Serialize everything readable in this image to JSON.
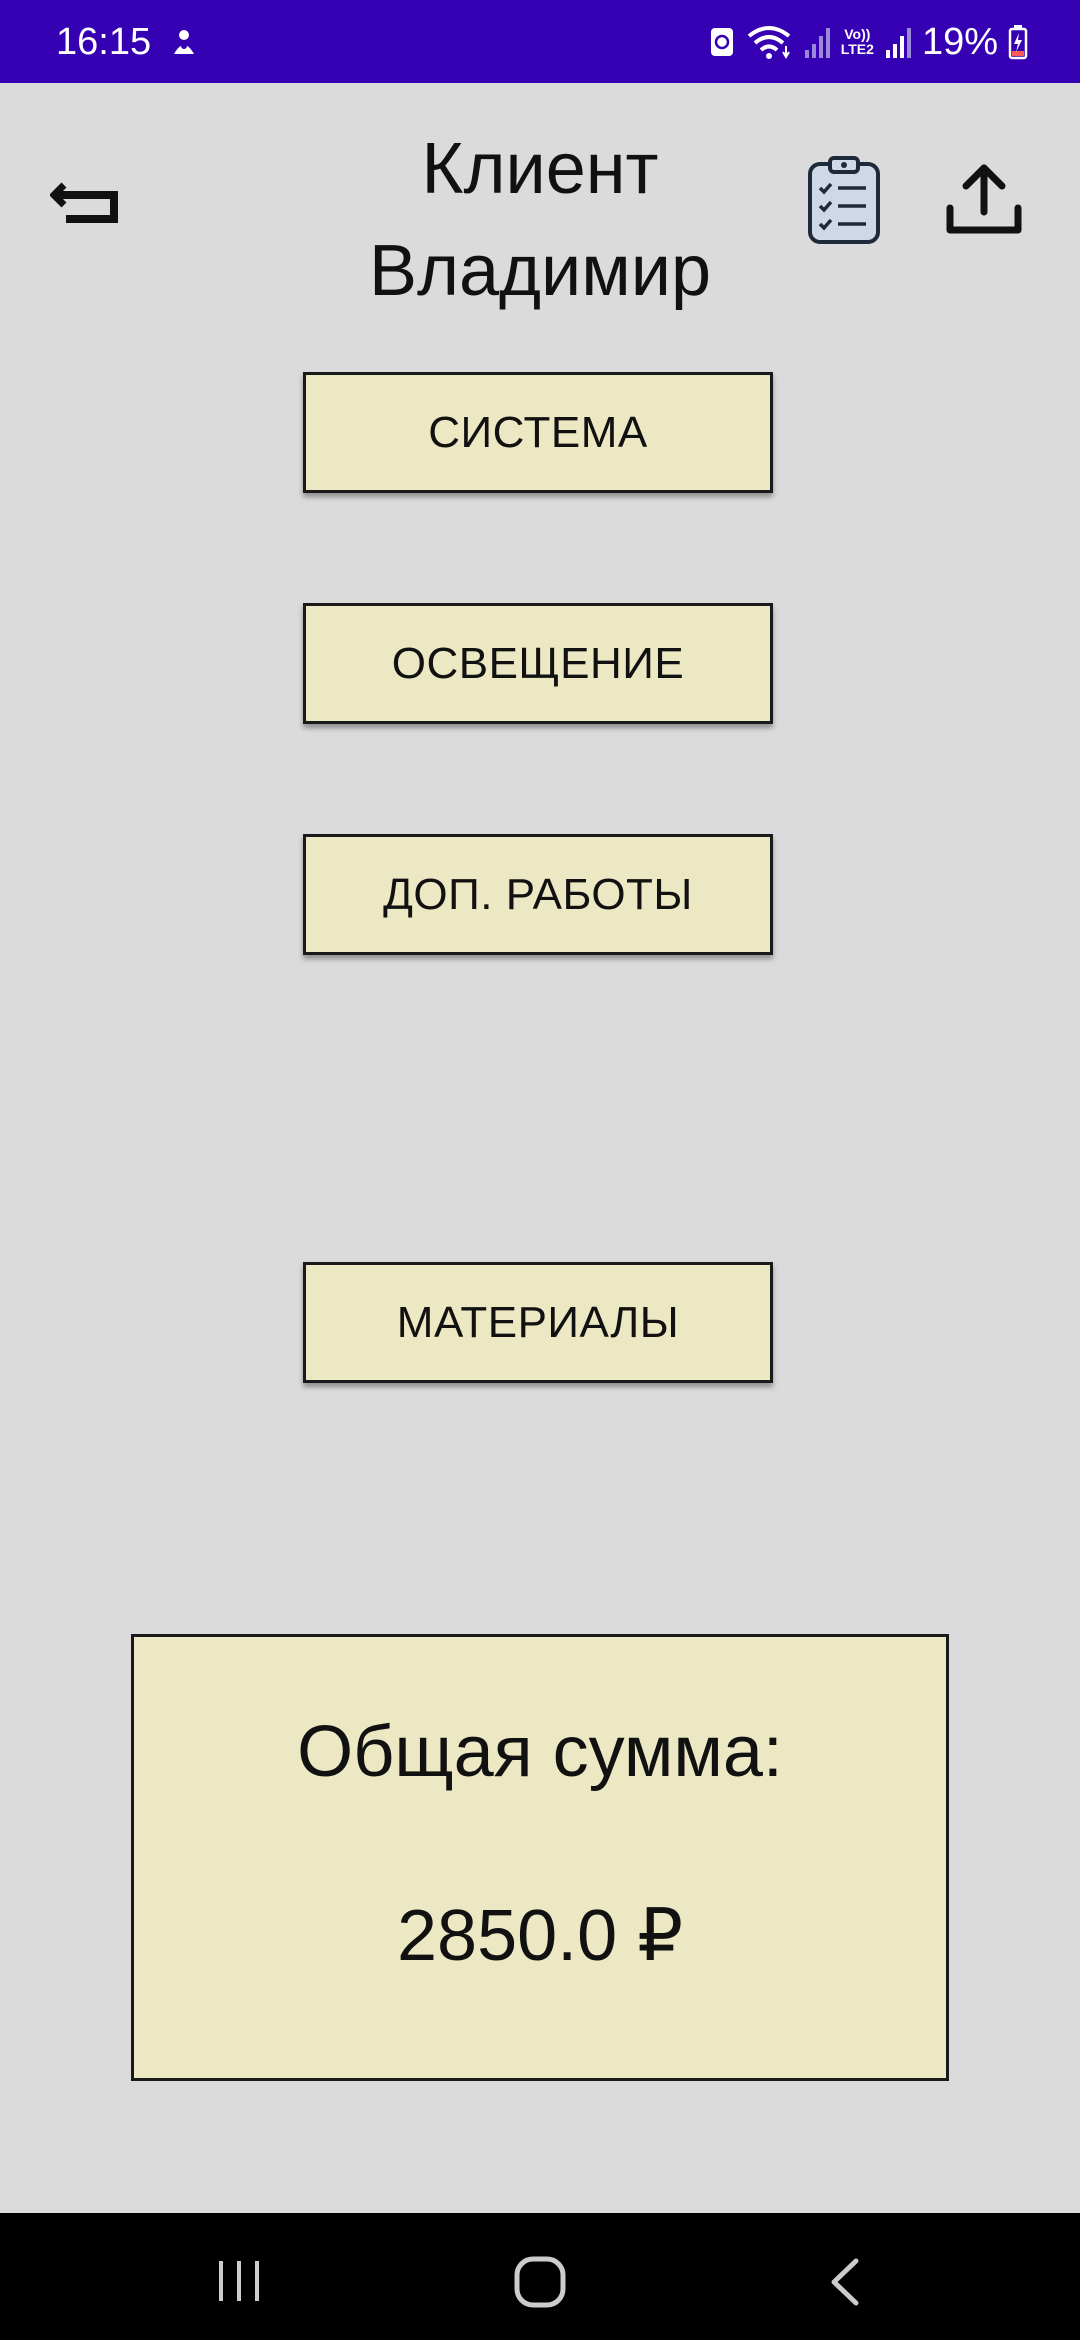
{
  "status_bar": {
    "time": "16:15",
    "lte_label": "Vo))\nLTE2",
    "battery_percent": "19%",
    "background_color": "#3600b3"
  },
  "header": {
    "title": "Клиент Владимир",
    "back_icon": "back-return-icon",
    "clipboard_icon": "clipboard-checklist-icon",
    "share_icon": "share-upload-icon"
  },
  "menu": {
    "items": [
      {
        "label": "СИСТЕМА"
      },
      {
        "label": "ОСВЕЩЕНИЕ"
      },
      {
        "label": "ДОП. РАБОТЫ"
      },
      {
        "label": "МАТЕРИАЛЫ"
      }
    ]
  },
  "total": {
    "label": "Общая сумма:",
    "value": "2850.0 ₽"
  },
  "colors": {
    "background": "#dbdbdb",
    "button_fill": "#ede8c4",
    "border": "#1a1a1a"
  },
  "nav_bar": {
    "recent_icon": "recent-apps-icon",
    "home_icon": "home-icon",
    "back_icon": "nav-back-icon"
  }
}
